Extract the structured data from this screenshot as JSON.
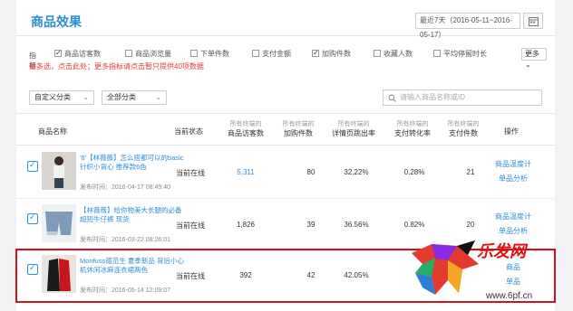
{
  "title": "商品效果",
  "date_range": "最近7天（2016-05-11~2016-05-17）",
  "filters": {
    "label": "指标：",
    "metrics": [
      {
        "label": "商品访客数",
        "checked": true
      },
      {
        "label": "商品浏览量",
        "checked": false
      },
      {
        "label": "下单件数",
        "checked": false
      },
      {
        "label": "支付金额",
        "checked": false
      },
      {
        "label": "加购件数",
        "checked": true
      },
      {
        "label": "收藏人数",
        "checked": false
      },
      {
        "label": "平均停留时长",
        "checked": false
      }
    ],
    "hint": "最多选，点击此处；更多指标请点击暂只提供40项数据",
    "more_label": "更多"
  },
  "selects": {
    "category": "自定义分类",
    "type": "全部分类"
  },
  "search": {
    "placeholder": "请输入商品名称或ID"
  },
  "table": {
    "headers": {
      "name": "商品名称",
      "status": "当前状态",
      "visitors": "商品访客数",
      "visitors_sub": "所有终端的",
      "cart": "加购件数",
      "cart_sub": "所有终端的",
      "conversion": "详情页跳出率",
      "conversion_sub": "所有终端的",
      "pay_rate": "支付转化率",
      "pay_rate_sub": "所有终端的",
      "pay_count": "支付件数",
      "pay_count_sub": "所有终端的",
      "action": "操作"
    },
    "rows": [
      {
        "name": "'8'【林薇薇】怎么搭都可以的basic针织小背心 推荐款6色",
        "time": "发布时间：2016-04-17 08:49:40",
        "status": "当前在线",
        "visitors": "5,311",
        "cart": "80",
        "bounce": "32.22%",
        "pay_rate": "0.28%",
        "pay_count": "21",
        "action1": "商品温度计",
        "action2": "单品分析"
      },
      {
        "name": "【林薇薇】给你物美大长腿的必备超短牛仔裤 现货",
        "time": "发布时间：2016-03-22 08:26:01",
        "status": "当前在线",
        "visitors": "1,826",
        "cart": "39",
        "bounce": "36.56%",
        "pay_rate": "0.82%",
        "pay_count": "20",
        "action1": "商品温度计",
        "action2": "单品分析"
      },
      {
        "name": "Monfuss德范生 夏季新品 背后小心机休闲冰麻连衣裙两色",
        "time": "发布时间：2016-05-14 12:09:07",
        "status": "当前在线",
        "visitors": "392",
        "cart": "42",
        "bounce": "42.05%",
        "pay_rate": "",
        "pay_count": "",
        "action1": "商品",
        "action2": "单品"
      }
    ]
  },
  "watermark": {
    "text": "乐发网",
    "url": "www.6pf.cn"
  }
}
